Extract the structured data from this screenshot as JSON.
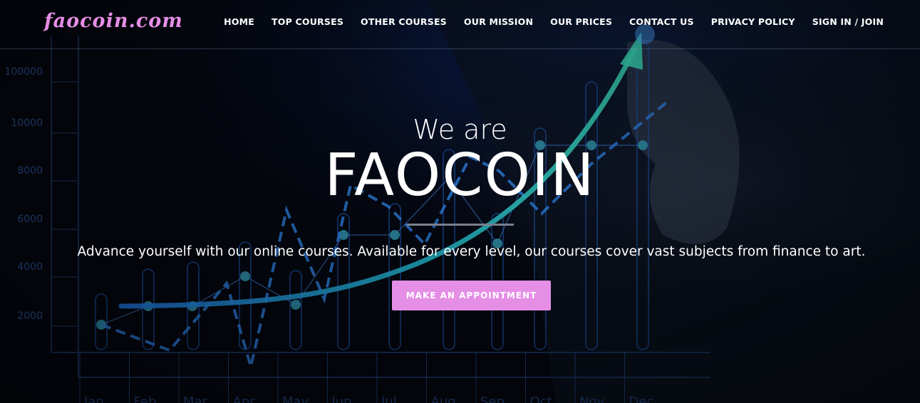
{
  "brand": {
    "logo": "faocoin.com"
  },
  "nav": {
    "items": [
      {
        "label": "HOME"
      },
      {
        "label": "TOP COURSES"
      },
      {
        "label": "OTHER COURSES"
      },
      {
        "label": "OUR MISSION"
      },
      {
        "label": "OUR PRICES"
      },
      {
        "label": "CONTACT US"
      },
      {
        "label": "PRIVACY POLICY"
      },
      {
        "label": "SIGN IN / JOIN"
      }
    ]
  },
  "hero": {
    "pre_title": "We are",
    "title": "FAOCOIN",
    "description": "Advance yourself with our online courses. Available for every level, our courses cover vast subjects from finance to art.",
    "cta_label": "MAKE AN APPOINTMENT"
  },
  "background": {
    "y_ticks": [
      "100000",
      "10000",
      "8000",
      "6000",
      "4000",
      "2000"
    ],
    "x_ticks": [
      "Jan",
      "Feb",
      "Mar",
      "Apr",
      "May",
      "Jun",
      "Jul",
      "Aug",
      "Sep",
      "Oct",
      "Nov",
      "Dec"
    ]
  },
  "colors": {
    "accent": "#e58ee6",
    "background": "#04070f"
  }
}
